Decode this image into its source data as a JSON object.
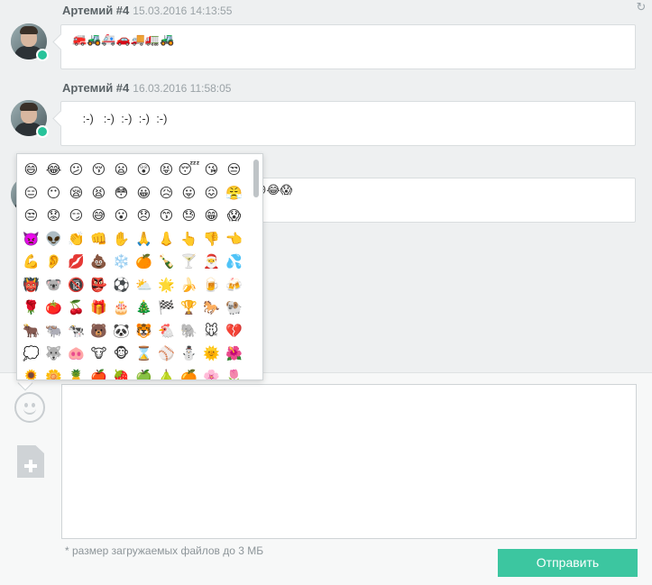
{
  "messages": [
    {
      "author": "Артемий #4",
      "date": "15.03.2016 14:13:55",
      "text": "🚒🚜🚑🚗🚚🚛🚜"
    },
    {
      "author": "Артемий #4",
      "date": "16.03.2016 11:58:05",
      "text": " :-)   :-)  :-)  :-)  :-)"
    },
    {
      "author": "",
      "date": "",
      "text": "😪😫😳😃😥😒😖😤😟😣😏😅😮😞😙😓😂😱"
    }
  ],
  "emoji_picker": {
    "emojis": [
      "😄",
      "😂",
      "😕",
      "😚",
      "😦",
      "😲",
      "😝",
      "😴",
      "😘",
      "😒",
      "😑",
      "😶",
      "😪",
      "😫",
      "😳",
      "😀",
      "😥",
      "😛",
      "😖",
      "😤",
      "😒",
      "😟",
      "😏",
      "😅",
      "😮",
      "😞",
      "😙",
      "😓",
      "😁",
      "😱",
      "👿",
      "👽",
      "👏",
      "👊",
      "✋",
      "🙏",
      "👃",
      "👆",
      "👎",
      "👈",
      "💪",
      "👂",
      "💋",
      "💩",
      "❄️",
      "🍊",
      "🍾",
      "🍸",
      "🎅",
      "💦",
      "👹",
      "🐨",
      "🔞",
      "👺",
      "⚽",
      "⛅",
      "🌟",
      "🍌",
      "🍺",
      "🍻",
      "🌹",
      "🍅",
      "🍒",
      "🎁",
      "🎂",
      "🎄",
      "🏁",
      "🏆",
      "🐎",
      "🐏",
      "🐂",
      "🐃",
      "🐄",
      "🐻",
      "🐼",
      "🐯",
      "🐔",
      "🐘",
      "🐭",
      "💔",
      "💭",
      "🐺",
      "🐽",
      "🐮",
      "🐵",
      "⌛",
      "⚾",
      "⛄",
      "🌞",
      "🌺",
      "🌻",
      "🌼",
      "🍍",
      "🍎",
      "🍓",
      "🍏",
      "🍐",
      "🍊",
      "🌸",
      "🌷"
    ]
  },
  "compose": {
    "placeholder": "",
    "hint": "* размер загружаемых файлов до 3 МБ",
    "send_label": "Отправить"
  },
  "icons": {
    "refresh": "refresh-icon",
    "smile": "smile-icon",
    "attach": "attach-file-icon"
  },
  "colors": {
    "accent": "#3cc6a0",
    "online": "#27c39a",
    "background": "#eef0f1"
  }
}
